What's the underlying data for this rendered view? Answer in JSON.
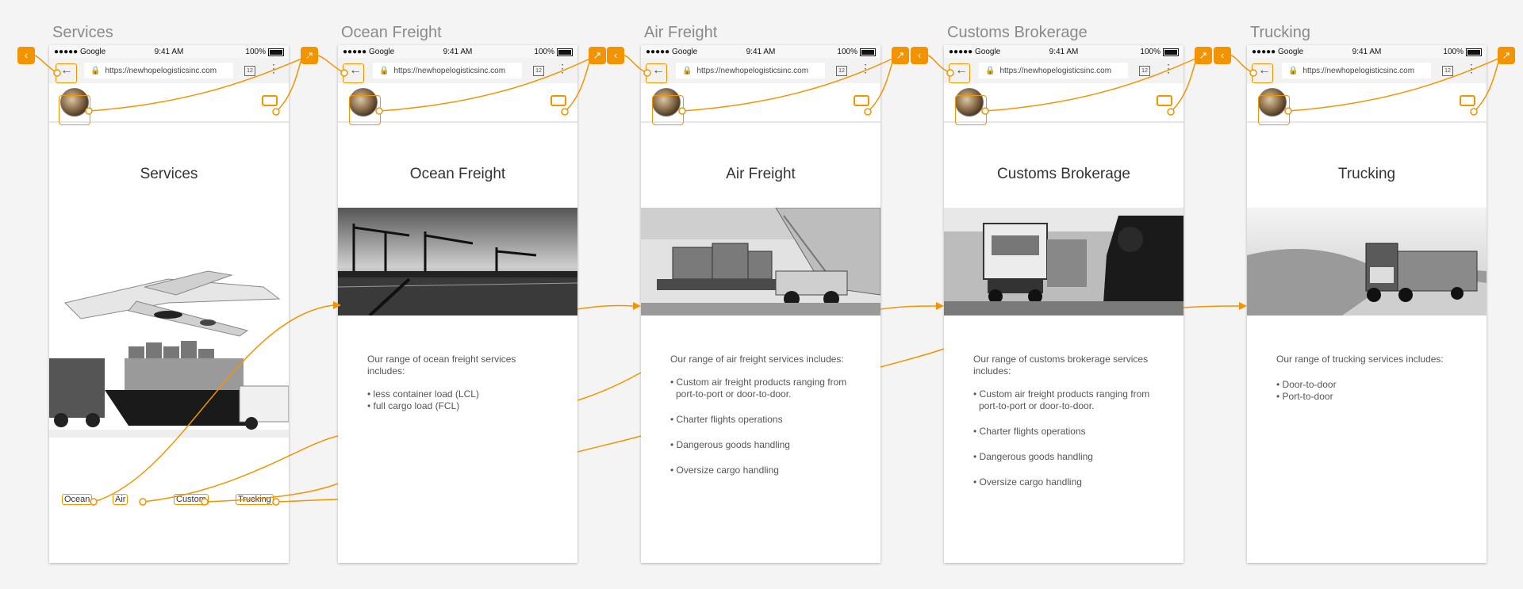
{
  "boards": [
    {
      "id": "services",
      "title": "Services",
      "page_title": "Services"
    },
    {
      "id": "ocean",
      "title": "Ocean Freight",
      "page_title": "Ocean Freight",
      "intro": "Our range of ocean freight services includes:",
      "items": [
        "• less container load (LCL)",
        "• full cargo load (FCL)"
      ]
    },
    {
      "id": "air",
      "title": "Air Freight",
      "page_title": "Air Freight",
      "intro": "Our range of air freight services includes:",
      "items": [
        "• Custom air freight products ranging from port-to-port or door-to-door.",
        "• Charter flights operations",
        "• Dangerous goods handling",
        "• Oversize cargo handling"
      ]
    },
    {
      "id": "customs",
      "title": "Customs Brokerage",
      "page_title": "Customs Brokerage",
      "intro": "Our range of customs brokerage services includes:",
      "items": [
        "• Custom air freight products ranging from port-to-port or door-to-door.",
        "• Charter flights operations",
        "• Dangerous goods handling",
        "• Oversize cargo handling"
      ]
    },
    {
      "id": "trucking",
      "title": "Trucking",
      "page_title": "Trucking",
      "intro": "Our range of trucking services includes:",
      "items": [
        "• Door-to-door",
        "• Port-to-door"
      ]
    }
  ],
  "status_bar": {
    "carrier": "●●●●● Google",
    "time": "9:41 AM",
    "battery": "100%"
  },
  "browser": {
    "url": "https://newhopelogisticsinc.com",
    "tabs_count": "12",
    "menu": "⋮",
    "back": "←",
    "lock": "🔒"
  },
  "service_links": [
    "Ocean",
    "Air",
    "Custom",
    "Trucking"
  ],
  "icons": {
    "back_button": "‹",
    "external_button": "↗"
  },
  "colors": {
    "accent": "#f39300",
    "background": "#f4f4f4"
  }
}
